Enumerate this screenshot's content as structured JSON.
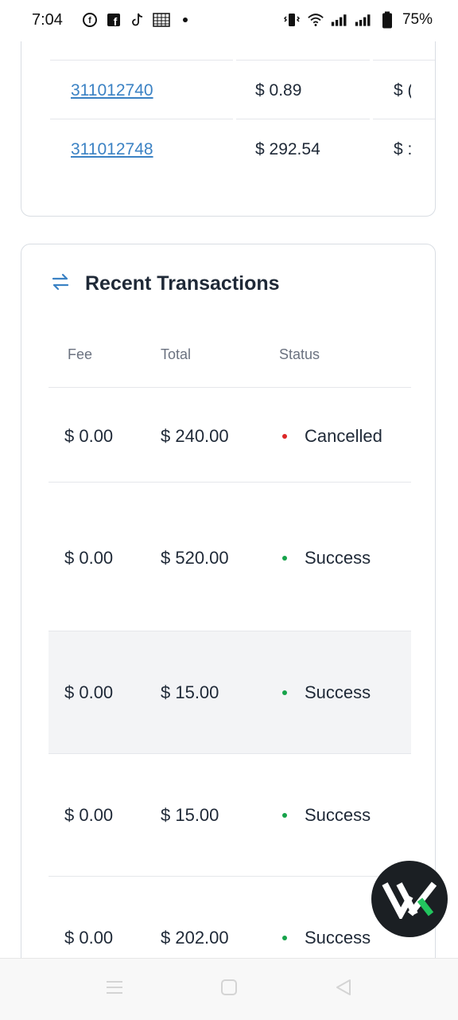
{
  "status_bar": {
    "time": "7:04",
    "battery": "75%",
    "left_icons": [
      "facebook-messenger-icon",
      "facebook-icon",
      "tiktok-icon",
      "grid-calendar-icon",
      "dot-icon"
    ],
    "right_icons": [
      "vibrate-icon",
      "wifi-icon",
      "signal-icon",
      "signal-icon",
      "battery-icon"
    ]
  },
  "top_table": {
    "rows": [
      {
        "id": "311012740",
        "amount": "$ 0.89",
        "third": "$ ("
      },
      {
        "id": "311012748",
        "amount": "$ 292.54",
        "third": "$ :"
      }
    ]
  },
  "transactions": {
    "title": "Recent Transactions",
    "icon": "arrows-exchange-icon",
    "headers": {
      "fee": "Fee",
      "total": "Total",
      "status": "Status"
    },
    "rows": [
      {
        "fee": "$ 0.00",
        "total": "$ 240.00",
        "status": "Cancelled",
        "status_color": "#dc2626"
      },
      {
        "fee": "$ 0.00",
        "total": "$ 520.00",
        "status": "Success",
        "status_color": "#16a34a"
      },
      {
        "fee": "$ 0.00",
        "total": "$ 15.00",
        "status": "Success",
        "status_color": "#16a34a"
      },
      {
        "fee": "$ 0.00",
        "total": "$ 15.00",
        "status": "Success",
        "status_color": "#16a34a"
      },
      {
        "fee": "$ 0.00",
        "total": "$ 202.00",
        "status": "Success",
        "status_color": "#16a34a"
      }
    ]
  },
  "colors": {
    "link": "#3b82c4",
    "success": "#16a34a",
    "cancelled": "#dc2626",
    "row_highlight": "#f3f4f6"
  },
  "nav": [
    "recents-icon",
    "home-icon",
    "back-icon"
  ],
  "fab": {
    "icon": "logo-icon"
  }
}
